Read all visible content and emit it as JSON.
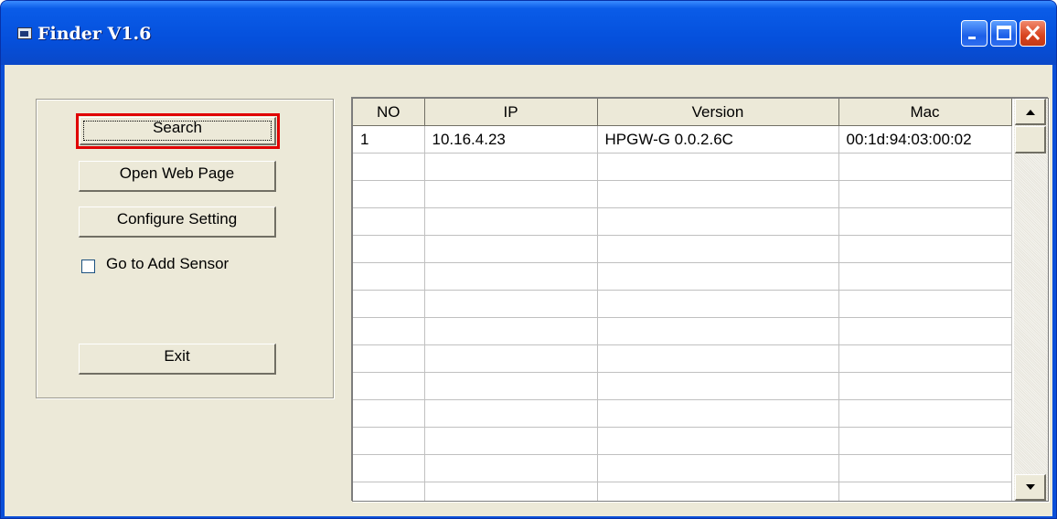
{
  "window": {
    "title": "Finder V1.6",
    "controls": {
      "minimize": "minimize-icon",
      "maximize": "maximize-icon",
      "close": "close-icon"
    }
  },
  "actions": {
    "search": "Search",
    "open_web_page": "Open Web Page",
    "configure_setting": "Configure Setting",
    "go_to_add_sensor": "Go to Add Sensor",
    "go_to_add_sensor_checked": false,
    "exit": "Exit"
  },
  "table": {
    "columns": [
      "NO",
      "IP",
      "Version",
      "Mac"
    ],
    "rows": [
      [
        "1",
        "10.16.4.23",
        "HPGW-G  0.0.2.6C",
        "00:1d:94:03:00:02"
      ]
    ]
  },
  "colors": {
    "titlebar": "#0550dc",
    "highlight": "#e00000",
    "face": "#ece9d8"
  }
}
